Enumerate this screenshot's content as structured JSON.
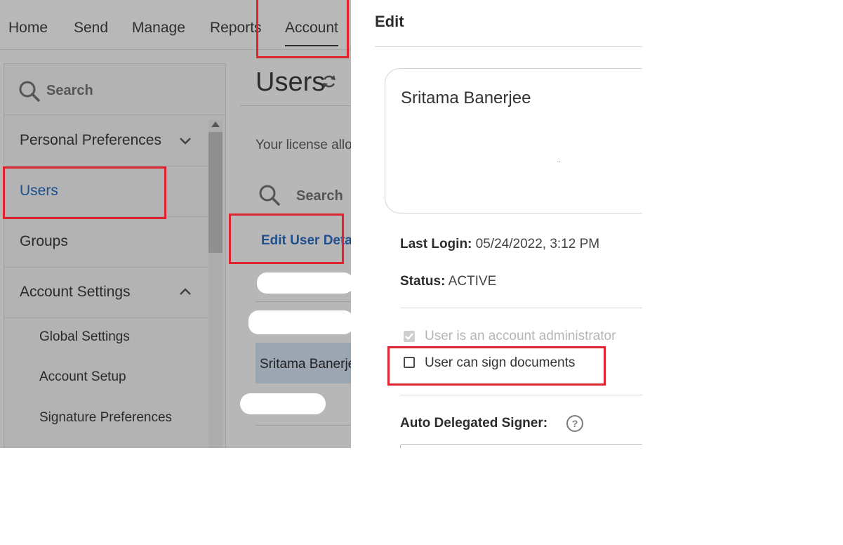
{
  "topnav": {
    "items": [
      "Home",
      "Send",
      "Manage",
      "Reports",
      "Account"
    ],
    "active": "Account"
  },
  "sidebar": {
    "search_placeholder": "Search",
    "items": [
      {
        "label": "Personal Preferences",
        "icon": "chevron-down-icon"
      },
      {
        "label": "Users"
      },
      {
        "label": "Groups"
      },
      {
        "label": "Account Settings",
        "icon": "chevron-up-icon"
      }
    ],
    "subitems": [
      "Global Settings",
      "Account Setup",
      "Signature Preferences"
    ]
  },
  "main": {
    "title": "Users",
    "license_text": "Your license allo",
    "search_placeholder": "Search",
    "edit_link": "Edit User Deta",
    "selected_row": "Sritama Banerje"
  },
  "edit_panel": {
    "title": "Edit",
    "user_name": "Sritama Banerjee",
    "last_login_label": "Last Login:",
    "last_login_value": "05/24/2022, 3:12 PM",
    "status_label": "Status:",
    "status_value": "ACTIVE",
    "admin_checkbox": {
      "label": "User is an account administrator",
      "checked": true,
      "disabled": true
    },
    "sign_checkbox": {
      "label": "User can sign documents",
      "checked": false
    },
    "auto_delegated_label": "Auto Delegated Signer:",
    "help_glyph": "?"
  },
  "colors": {
    "highlight": "#e0242f",
    "link": "#1f4f8f",
    "overlay": "#b7b7b7"
  }
}
